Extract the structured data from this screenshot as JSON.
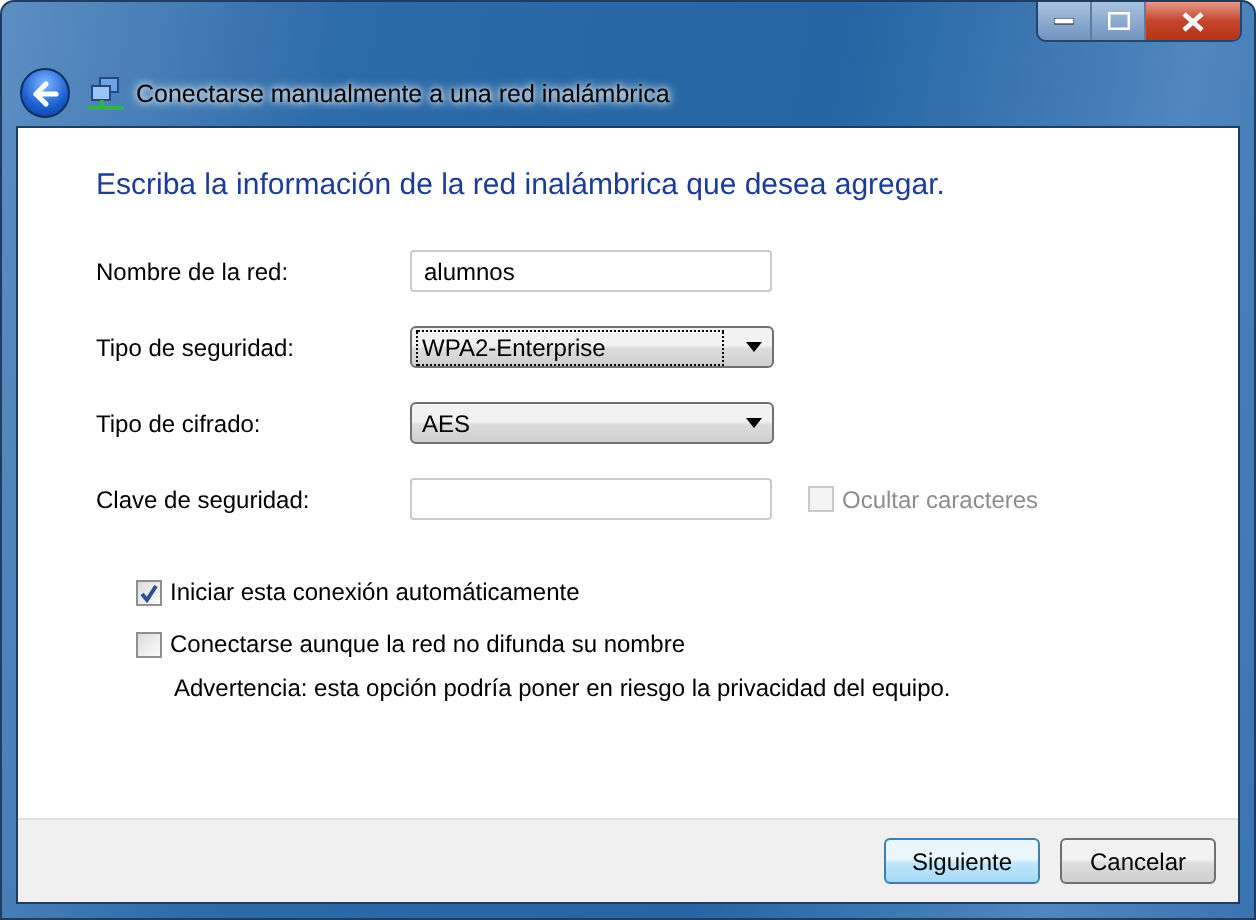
{
  "window": {
    "title": "Conectarse manualmente a una red inalámbrica"
  },
  "heading": "Escriba la información de la red inalámbrica que desea agregar.",
  "fields": [
    {
      "kind": "text",
      "label": "Nombre de la red:",
      "value": "alumnos",
      "focused": false
    },
    {
      "kind": "dropdown",
      "label": "Tipo de seguridad:",
      "value": "WPA2-Enterprise",
      "focused": true
    },
    {
      "kind": "dropdown",
      "label": "Tipo de cifrado:",
      "value": "AES",
      "focused": false
    },
    {
      "kind": "text",
      "label": "Clave de seguridad:",
      "focused": false,
      "side_checkbox": {
        "label": "Ocultar caracteres",
        "checked": false,
        "disabled": true
      }
    }
  ],
  "options": [
    {
      "label": "Iniciar esta conexión automáticamente",
      "checked": true
    },
    {
      "label": "Conectarse aunque la red no difunda su nombre",
      "checked": false,
      "note": "Advertencia: esta opción podría poner en riesgo la privacidad del equipo."
    }
  ],
  "buttons": [
    {
      "label": "Siguiente",
      "default": true
    },
    {
      "label": "Cancelar",
      "default": false
    }
  ]
}
